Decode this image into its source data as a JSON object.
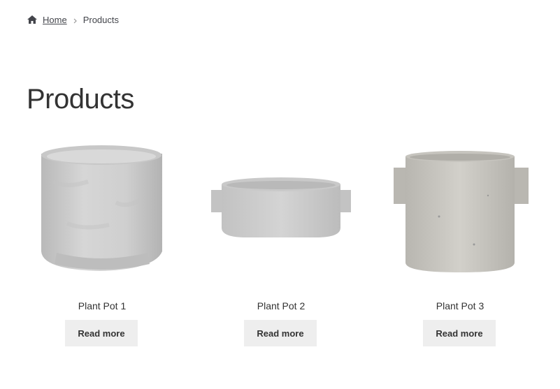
{
  "breadcrumb": {
    "home_icon": "home-icon",
    "home_label": "Home",
    "separator_icon": "chevron-right-icon",
    "current_label": "Products"
  },
  "page": {
    "title": "Products"
  },
  "products": [
    {
      "title": "Plant Pot 1",
      "button_label": "Read more",
      "image": "round-concrete-pot"
    },
    {
      "title": "Plant Pot 2",
      "button_label": "Read more",
      "image": "oval-concrete-planter-with-handles"
    },
    {
      "title": "Plant Pot 3",
      "button_label": "Read more",
      "image": "cylindrical-concrete-pot-with-handles"
    }
  ],
  "colors": {
    "text": "#43454b",
    "button_bg": "#eeeeee"
  }
}
